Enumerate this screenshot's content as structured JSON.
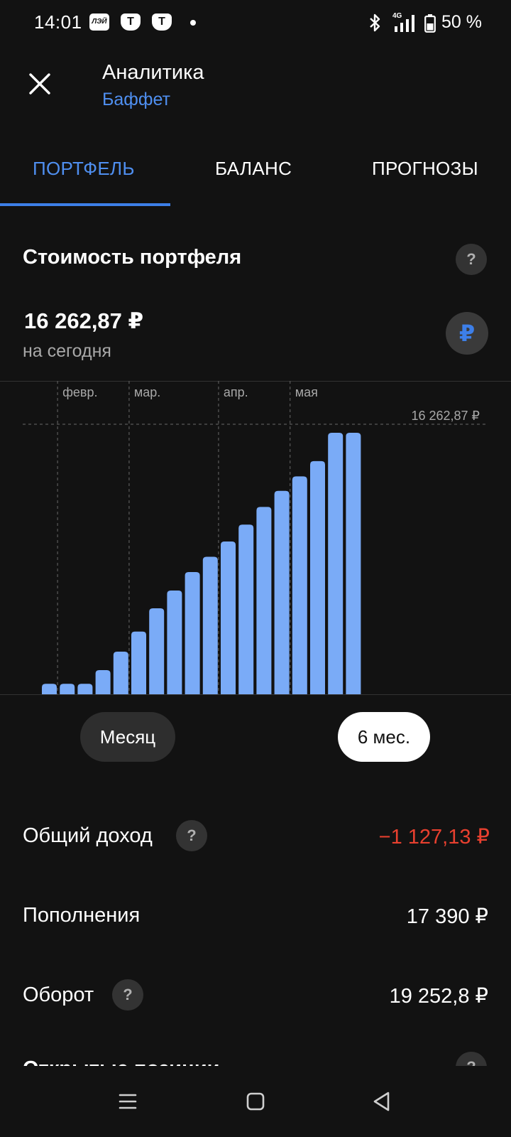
{
  "status_bar": {
    "time": "14:01",
    "app_icons": [
      "ЛЭЙ",
      "Т",
      "Т"
    ],
    "network": "4G",
    "battery": "50 %"
  },
  "header": {
    "title": "Аналитика",
    "subtitle": "Баффет"
  },
  "tabs": [
    {
      "label": "ПОРТФЕЛЬ",
      "active": true
    },
    {
      "label": "БАЛАНС",
      "active": false
    },
    {
      "label": "ПРОГНОЗЫ",
      "active": false
    }
  ],
  "portfolio": {
    "section_title": "Стоимость портфеля",
    "help_icon": "?",
    "value": "16 262,87  ₽",
    "caption": "на сегодня",
    "currency_symbol": "₽"
  },
  "chart_data": {
    "type": "bar",
    "month_labels": [
      "февр.",
      "мар.",
      "апр.",
      "мая"
    ],
    "max_label": "16 262,87 ₽",
    "ylim": [
      0,
      16262.87
    ],
    "values": [
      650,
      650,
      650,
      1500,
      2650,
      3900,
      5350,
      6450,
      7600,
      8550,
      9500,
      10550,
      11650,
      12650,
      13550,
      14500,
      16262.87,
      16262.87
    ],
    "month_start_index": [
      1,
      5,
      10,
      14
    ],
    "colors": {
      "bar": "#7aabf7",
      "grid": "#5a5a5a",
      "label": "#a8a8a8"
    }
  },
  "periods": [
    {
      "label": "Месяц",
      "selected": false
    },
    {
      "label": "6 мес.",
      "selected": true
    }
  ],
  "stats": {
    "income_label": "Общий доход",
    "income_value": "−1 127,13 ₽",
    "deposits_label": "Пополнения",
    "deposits_value": "17 390 ₽",
    "turnover_label": "Оборот",
    "turnover_value": "19 252,8 ₽"
  },
  "positions": {
    "title": "Открытые позиции"
  },
  "colors": {
    "accent": "#4f8ff0",
    "negative": "#e8402f",
    "background": "#121212"
  }
}
